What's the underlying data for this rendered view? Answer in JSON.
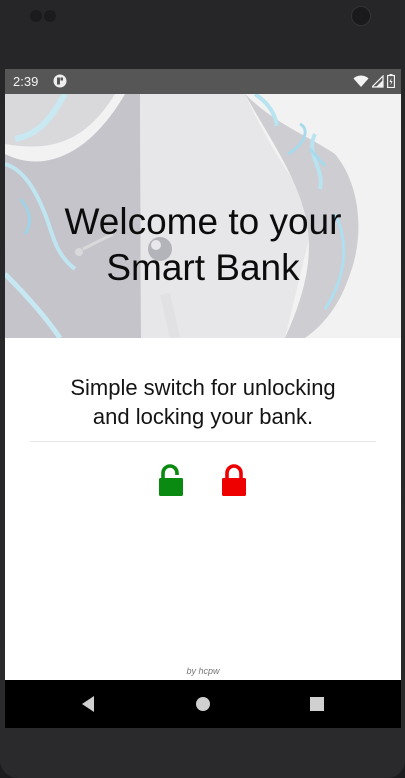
{
  "status_bar": {
    "time": "2:39",
    "icons": [
      "app-notification-icon",
      "wifi-icon",
      "signal-icon",
      "battery-icon"
    ]
  },
  "hero": {
    "title": "Welcome to your\nSmart Bank"
  },
  "main": {
    "subtitle": "Simple switch for unlocking\nand locking your bank.",
    "unlock_icon_color": "#0b8a12",
    "lock_icon_color": "#ee0000"
  },
  "footer": {
    "credit": "by hcpw"
  },
  "nav": {
    "buttons": [
      "back-icon",
      "home-icon",
      "recents-icon"
    ]
  }
}
